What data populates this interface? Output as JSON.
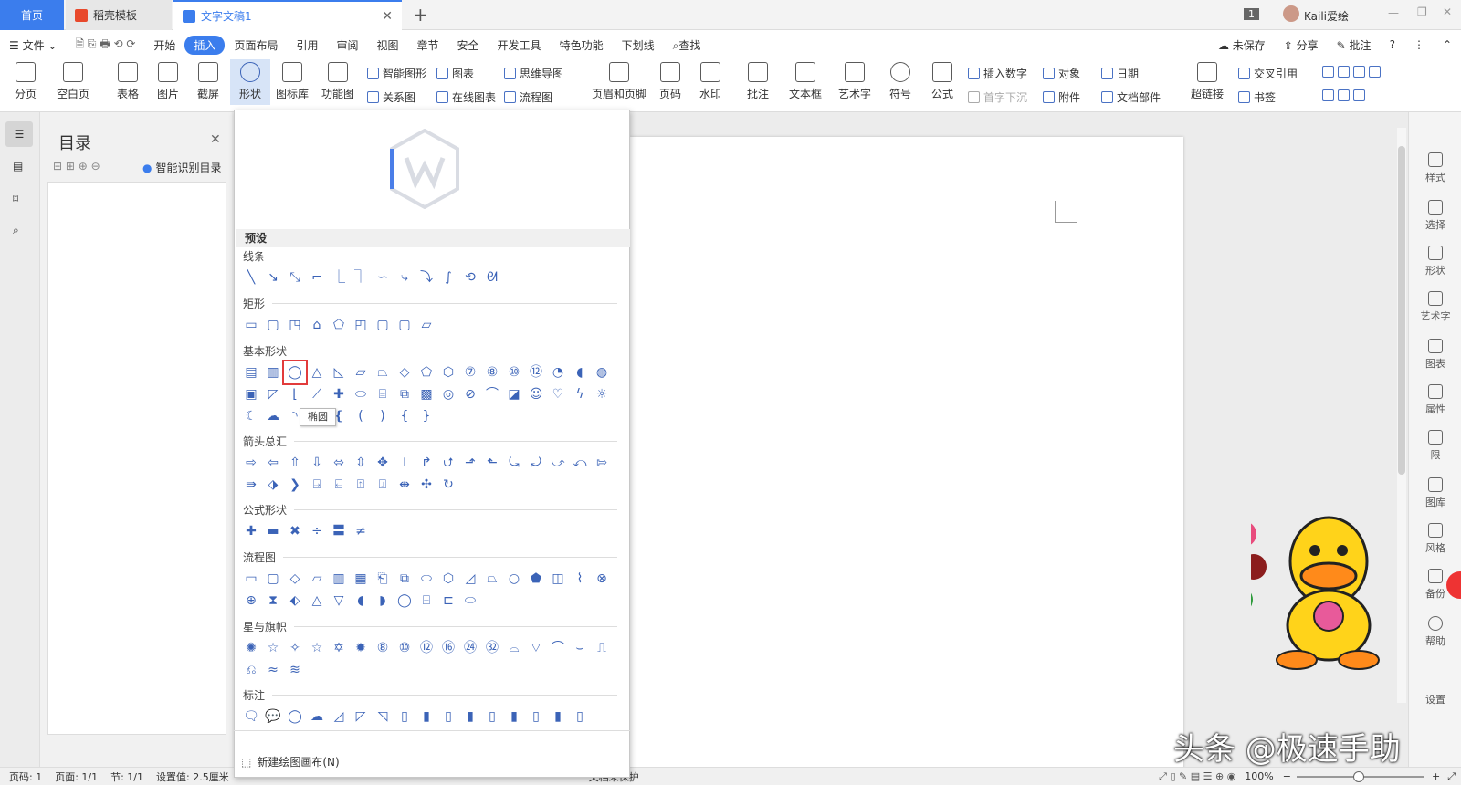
{
  "tabs": {
    "home": "首页",
    "template": "稻壳模板",
    "doc": "文字文稿1",
    "add": "+"
  },
  "window": {
    "page_indicator": "1",
    "user": "Kaili爱绘"
  },
  "menu": {
    "file": "文件",
    "items": [
      "开始",
      "插入",
      "页面布局",
      "引用",
      "审阅",
      "视图",
      "章节",
      "安全",
      "开发工具",
      "特色功能",
      "下划线"
    ],
    "search": "查找",
    "unsaved": "未保存",
    "share": "分享",
    "comment": "批注"
  },
  "ribbon": {
    "big": [
      "分页",
      "空白页",
      "表格",
      "图片",
      "截屏",
      "形状",
      "图标库",
      "功能图"
    ],
    "small_a": [
      "智能图形",
      "图表",
      "思维导图",
      "关系图",
      "在线图表",
      "流程图"
    ],
    "big2": [
      "页眉和页脚",
      "页码",
      "水印",
      "批注",
      "文本框",
      "艺术字",
      "符号",
      "公式"
    ],
    "small_b": [
      "插入数字",
      "对象",
      "日期",
      "首字下沉",
      "附件",
      "文档部件"
    ],
    "big3": [
      "超链接"
    ],
    "small_c": [
      "交叉引用",
      "书签"
    ]
  },
  "toc": {
    "title": "目录",
    "smart": "智能识别目录"
  },
  "panel": {
    "preset": "预设",
    "sections": [
      "线条",
      "矩形",
      "基本形状",
      "箭头总汇",
      "公式形状",
      "流程图",
      "星与旗帜",
      "标注"
    ],
    "tooltip": "椭圆",
    "new_canvas": "新建绘图画布(N)"
  },
  "rightbar": [
    "样式",
    "选择",
    "形状",
    "艺术字",
    "图表",
    "属性",
    "限",
    "图库",
    "风格",
    "备份",
    "帮助",
    "设置"
  ],
  "status": {
    "page": "页码: 1",
    "pages": "页面: 1/1",
    "section": "节: 1/1",
    "settings": "设置值: 2.5厘米",
    "protect": "文档未保护",
    "zoom": "100%"
  },
  "watermark": "头条 @极速手助"
}
